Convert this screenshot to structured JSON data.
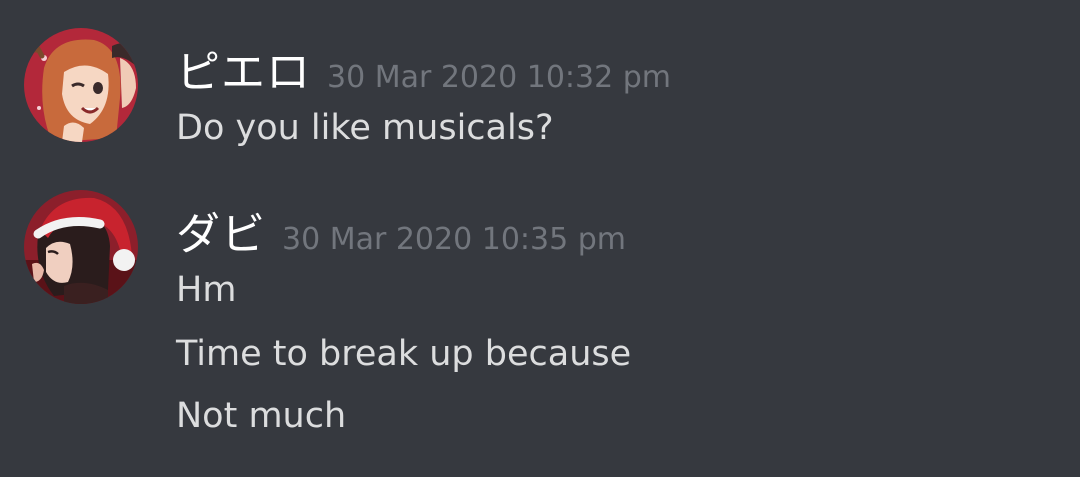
{
  "messages": [
    {
      "username": "ピエロ",
      "timestamp": "30 Mar 2020 10:32 pm",
      "avatar": "anime-girl-reindeer-avatar",
      "lines": [
        "Do you like musicals?"
      ]
    },
    {
      "username": "ダビ",
      "timestamp": "30 Mar 2020 10:35 pm",
      "avatar": "anime-boy-santa-hat-avatar",
      "lines": [
        "Hm",
        "Time to break up because",
        "Not much"
      ]
    }
  ],
  "colors": {
    "background": "#36393f",
    "username": "#ffffff",
    "timestamp": "#72767d",
    "message_text": "#dcddde"
  }
}
